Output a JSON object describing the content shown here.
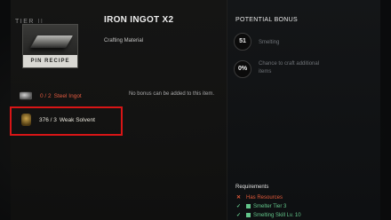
{
  "header": {
    "tier_label": "TIER",
    "tier_value": "II",
    "title": "IRON INGOT X2",
    "subtitle": "Crafting Material"
  },
  "recipe_card": {
    "pin_label": "PIN RECIPE"
  },
  "ingredients": [
    {
      "count": "0 / 2",
      "name": "Steel Ingot",
      "icon": "steel-ingot-icon"
    },
    {
      "count": "376 / 3",
      "name": "Weak Solvent",
      "icon": "weak-solvent-icon"
    }
  ],
  "bonus_note": "No bonus can be added to this item.",
  "potential_bonus": {
    "title": "POTENTIAL BONUS",
    "items": [
      {
        "value": "51",
        "label": "Smelting"
      },
      {
        "value": "0%",
        "label": "Chance to craft additional items"
      }
    ]
  },
  "requirements": {
    "title": "Requirements",
    "items": [
      {
        "mark": "✕",
        "label": "Has Resources",
        "status": "unmet"
      },
      {
        "mark": "✓",
        "label": "Smelter Tier 3",
        "status": "met"
      },
      {
        "mark": "✓",
        "label": "Smelting Skill Lv. 10",
        "status": "met"
      }
    ]
  },
  "colors": {
    "highlight_box": "#d81516",
    "unmet": "#e05a3f",
    "met": "#62c58a"
  }
}
